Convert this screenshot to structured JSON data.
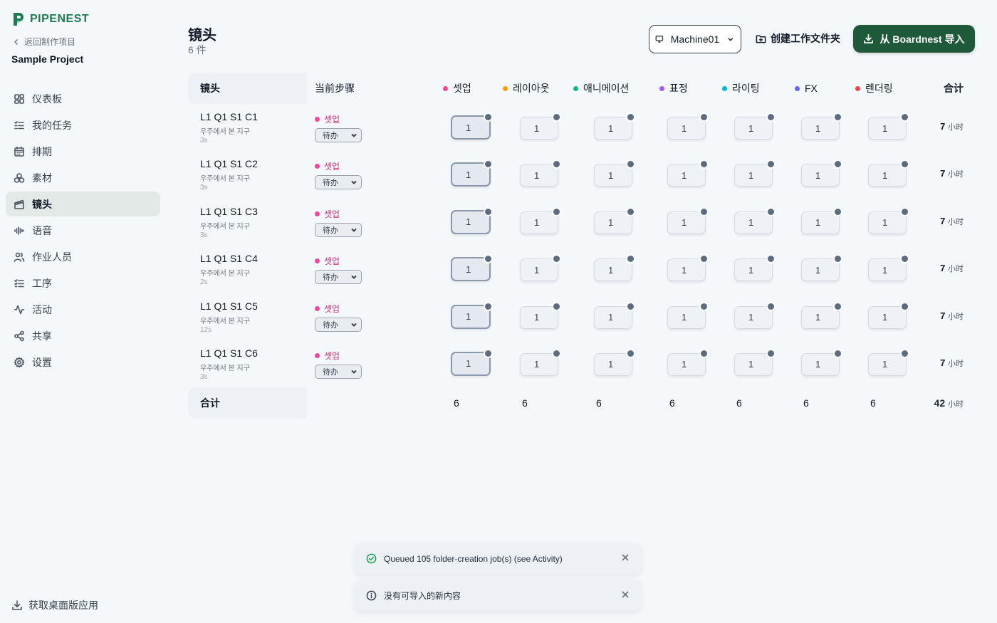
{
  "brand": {
    "name": "PIPENEST"
  },
  "sidebar": {
    "back_label": "返回制作项目",
    "project_name": "Sample Project",
    "items": [
      {
        "label": "仪表板",
        "icon": "dashboard-icon"
      },
      {
        "label": "我的任务",
        "icon": "task-list-icon"
      },
      {
        "label": "排期",
        "icon": "calendar-icon"
      },
      {
        "label": "素材",
        "icon": "assets-icon"
      },
      {
        "label": "镜头",
        "icon": "clapperboard-icon",
        "active": true
      },
      {
        "label": "语音",
        "icon": "audio-wave-icon"
      },
      {
        "label": "作业人员",
        "icon": "users-icon"
      },
      {
        "label": "工序",
        "icon": "checklist-icon"
      },
      {
        "label": "活动",
        "icon": "activity-icon"
      },
      {
        "label": "共享",
        "icon": "share-icon"
      },
      {
        "label": "设置",
        "icon": "gear-icon"
      }
    ],
    "desktop_app_label": "获取桌面版应用"
  },
  "header": {
    "title": "镜头",
    "count": "6 件",
    "machine": "Machine01",
    "folder_button": "创建工作文件夹",
    "import_button": "从 Boardnest 导入"
  },
  "table": {
    "col_shot": "镜头",
    "col_step": "当前步骤",
    "col_total": "合计",
    "steps": [
      {
        "label": "셋업",
        "color": "#ec4899"
      },
      {
        "label": "레이아웃",
        "color": "#f59e0b"
      },
      {
        "label": "애니메이션",
        "color": "#10b981"
      },
      {
        "label": "표정",
        "color": "#a855f7"
      },
      {
        "label": "라이팅",
        "color": "#06b6d4"
      },
      {
        "label": "FX",
        "color": "#6366f1"
      },
      {
        "label": "렌더링",
        "color": "#ef4444"
      }
    ],
    "rows": [
      {
        "name": "L1 Q1 S1 C1",
        "desc": "우주에서 본 지구",
        "dur": "3s",
        "step": "셋업",
        "status": "待办",
        "values": [
          "1",
          "1",
          "1",
          "1",
          "1",
          "1",
          "1"
        ],
        "total": "7",
        "unit": "小时"
      },
      {
        "name": "L1 Q1 S1 C2",
        "desc": "우주에서 본 지구",
        "dur": "3s",
        "step": "셋업",
        "status": "待办",
        "values": [
          "1",
          "1",
          "1",
          "1",
          "1",
          "1",
          "1"
        ],
        "total": "7",
        "unit": "小时"
      },
      {
        "name": "L1 Q1 S1 C3",
        "desc": "우주에서 본 지구",
        "dur": "3s",
        "step": "셋업",
        "status": "待办",
        "values": [
          "1",
          "1",
          "1",
          "1",
          "1",
          "1",
          "1"
        ],
        "total": "7",
        "unit": "小时"
      },
      {
        "name": "L1 Q1 S1 C4",
        "desc": "우주에서 본 지구",
        "dur": "2s",
        "step": "셋업",
        "status": "待办",
        "values": [
          "1",
          "1",
          "1",
          "1",
          "1",
          "1",
          "1"
        ],
        "total": "7",
        "unit": "小时"
      },
      {
        "name": "L1 Q1 S1 C5",
        "desc": "우주에서 본 지구",
        "dur": "12s",
        "step": "셋업",
        "status": "待办",
        "values": [
          "1",
          "1",
          "1",
          "1",
          "1",
          "1",
          "1"
        ],
        "total": "7",
        "unit": "小时"
      },
      {
        "name": "L1 Q1 S1 C6",
        "desc": "우주에서 본 지구",
        "dur": "3s",
        "step": "셋업",
        "status": "待办",
        "values": [
          "1",
          "1",
          "1",
          "1",
          "1",
          "1",
          "1"
        ],
        "total": "7",
        "unit": "小时"
      }
    ],
    "footer": {
      "label": "合计",
      "values": [
        "6",
        "6",
        "6",
        "6",
        "6",
        "6",
        "6"
      ],
      "total": "42",
      "unit": "小时"
    }
  },
  "toasts": [
    {
      "text": "Queued 105 folder-creation job(s) (see Activity)",
      "type": "success",
      "icon": "check-circle-icon",
      "color": "#16a34a"
    },
    {
      "text": "没有可导入的新内容",
      "type": "info",
      "icon": "info-circle-icon",
      "color": "#374151"
    }
  ]
}
